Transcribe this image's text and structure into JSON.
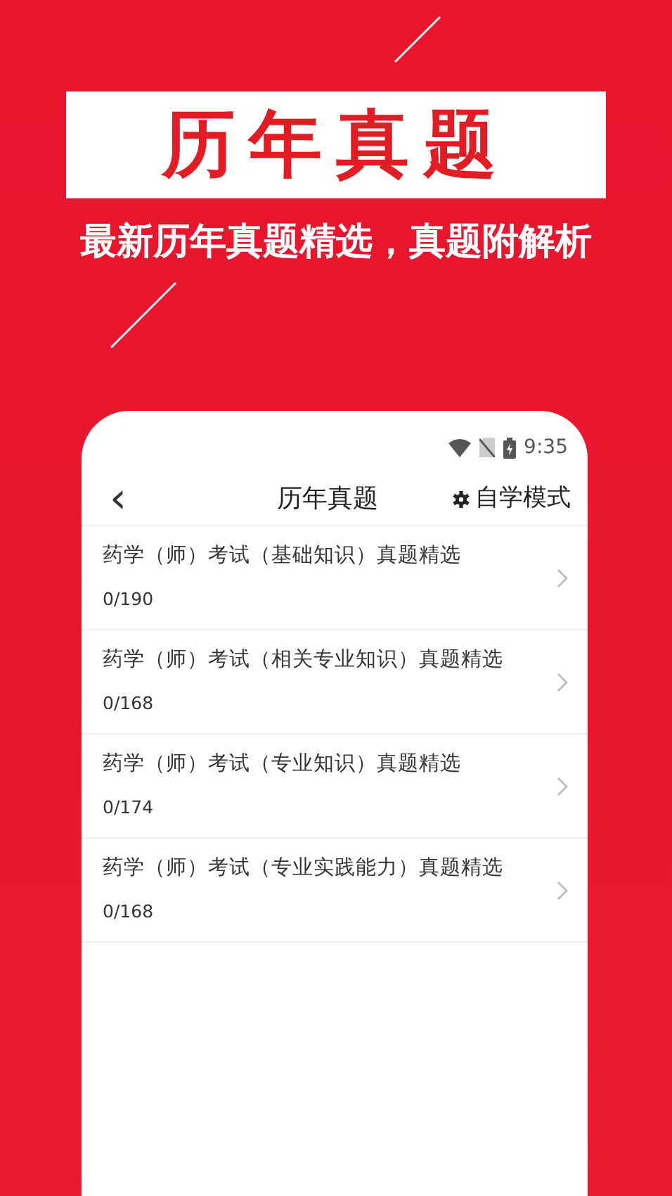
{
  "banner": {
    "title": "历年真题",
    "subtitle": "最新历年真题精选，真题附解析"
  },
  "status_bar": {
    "time": "9:35"
  },
  "header": {
    "back": "‹",
    "title": "历年真题",
    "mode": "自学模式"
  },
  "items": [
    {
      "title": "药学（师）考试（基础知识）真题精选",
      "progress": "0/190"
    },
    {
      "title": "药学（师）考试（相关专业知识）真题精选",
      "progress": "0/168"
    },
    {
      "title": "药学（师）考试（专业知识）真题精选",
      "progress": "0/174"
    },
    {
      "title": "药学（师）考试（专业实践能力）真题精选",
      "progress": "0/168"
    }
  ]
}
